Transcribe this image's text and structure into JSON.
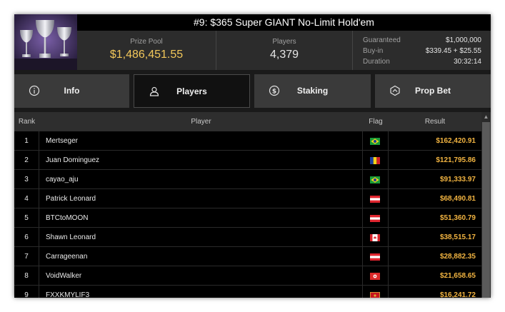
{
  "tournament": {
    "title": "#9: $365 Super GIANT No-Limit Hold'em",
    "prize_pool_label": "Prize Pool",
    "prize_pool": "$1,486,451.55",
    "players_label": "Players",
    "players": "4,379",
    "details": [
      {
        "label": "Guaranteed",
        "value": "$1,000,000"
      },
      {
        "label": "Buy-in",
        "value": "$339.45 + $25.55"
      },
      {
        "label": "Duration",
        "value": "30:32:14"
      }
    ]
  },
  "tabs": [
    {
      "label": "Info",
      "icon": "info-icon",
      "active": false
    },
    {
      "label": "Players",
      "icon": "user-icon",
      "active": true
    },
    {
      "label": "Staking",
      "icon": "dollar-coin-icon",
      "active": false
    },
    {
      "label": "Prop Bet",
      "icon": "prop-bet-icon",
      "active": false
    }
  ],
  "table": {
    "headers": {
      "rank": "Rank",
      "player": "Player",
      "flag": "Flag",
      "result": "Result"
    },
    "rows": [
      {
        "rank": "1",
        "player": "Mertseger",
        "flag": "brazil",
        "result": "$162,420.91"
      },
      {
        "rank": "2",
        "player": "Juan Dominguez",
        "flag": "andorra",
        "result": "$121,795.86"
      },
      {
        "rank": "3",
        "player": "cayao_aju",
        "flag": "brazil",
        "result": "$91,333.97"
      },
      {
        "rank": "4",
        "player": "Patrick Leonard",
        "flag": "austria",
        "result": "$68,490.81"
      },
      {
        "rank": "5",
        "player": "BTCtoMOON",
        "flag": "austria",
        "result": "$51,360.79"
      },
      {
        "rank": "6",
        "player": "Shawn Leonard",
        "flag": "canada",
        "result": "$38,515.17"
      },
      {
        "rank": "7",
        "player": "Carrageenan",
        "flag": "austria",
        "result": "$28,882.35"
      },
      {
        "rank": "8",
        "player": "VoidWalker",
        "flag": "hong-kong",
        "result": "$21,658.65"
      },
      {
        "rank": "9",
        "player": "FXXKMYLIF3",
        "flag": "montenegro",
        "result": "$16,241.72"
      }
    ]
  },
  "colors": {
    "prize": "#f2c75a",
    "result": "#f2b441",
    "background": "#1a1a1a",
    "row": "#000000"
  }
}
